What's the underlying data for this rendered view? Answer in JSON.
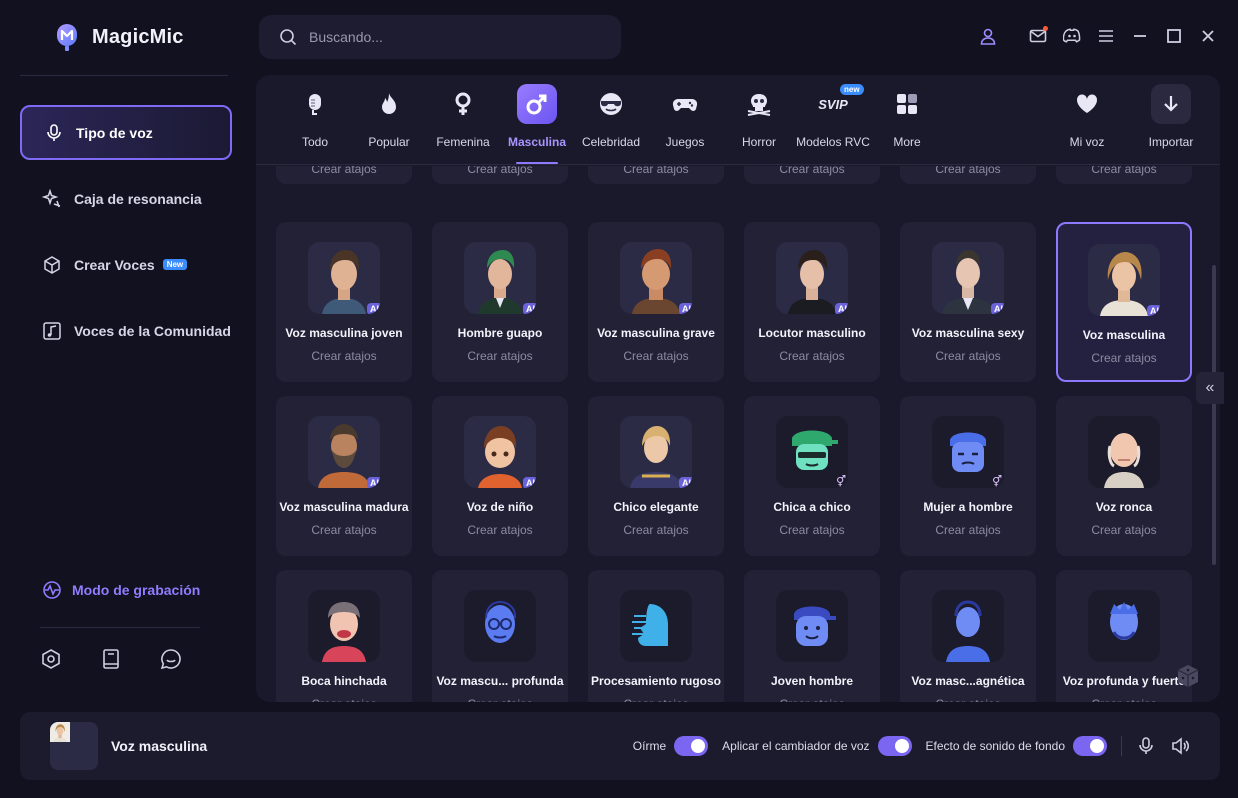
{
  "app": {
    "name": "MagicMic"
  },
  "search": {
    "placeholder": "Buscando..."
  },
  "sidebar": {
    "items": [
      {
        "label": "Tipo de voz",
        "icon": "microphone-icon",
        "active": true
      },
      {
        "label": "Caja de resonancia",
        "icon": "sparkle-icon"
      },
      {
        "label": "Crear Voces",
        "icon": "cube-icon",
        "badge": "New"
      },
      {
        "label": "Voces de la Comunidad",
        "icon": "music-note-icon"
      }
    ],
    "record_mode": "Modo de grabación"
  },
  "categories": [
    {
      "label": "Todo",
      "icon": "mic-icon"
    },
    {
      "label": "Popular",
      "icon": "flame-icon"
    },
    {
      "label": "Femenina",
      "icon": "female-symbol-icon"
    },
    {
      "label": "Masculina",
      "icon": "male-symbol-icon",
      "active": true
    },
    {
      "label": "Celebridad",
      "icon": "sunglasses-icon"
    },
    {
      "label": "Juegos",
      "icon": "gamepad-icon"
    },
    {
      "label": "Horror",
      "icon": "skull-icon"
    },
    {
      "label": "Modelos RVC",
      "icon": "svip-icon",
      "badge_text": "SVIP",
      "badge": "new"
    },
    {
      "label": "More",
      "icon": "grid-icon"
    },
    {
      "label": "Mi voz",
      "icon": "heart-icon"
    },
    {
      "label": "Importar",
      "icon": "download-icon"
    }
  ],
  "card_sub": "Crear atajos",
  "voices_row1": [
    {
      "name": "Voz masculina joven",
      "ai": "AI"
    },
    {
      "name": "Hombre guapo",
      "ai": "AI"
    },
    {
      "name": "Voz masculina grave",
      "ai": "AI"
    },
    {
      "name": "Locutor masculino",
      "ai": "AI"
    },
    {
      "name": "Voz masculina sexy",
      "ai": "AI"
    },
    {
      "name": "Voz masculina",
      "ai": "AI",
      "selected": true
    }
  ],
  "voices_row2": [
    {
      "name": "Voz masculina madura",
      "ai": "AI"
    },
    {
      "name": "Voz de niño",
      "ai": "AI"
    },
    {
      "name": "Chico elegante",
      "ai": "AI"
    },
    {
      "name": "Chica a chico",
      "gender": "⚥"
    },
    {
      "name": "Mujer a hombre",
      "gender": "⚥"
    },
    {
      "name": "Voz ronca"
    }
  ],
  "voices_row3": [
    {
      "name": "Boca hinchada"
    },
    {
      "name": "Voz mascu... profunda"
    },
    {
      "name": "Procesamiento rugoso"
    },
    {
      "name": "Joven hombre"
    },
    {
      "name": "Voz masc...agnética"
    },
    {
      "name": "Voz profunda y fuerte"
    }
  ],
  "bottom": {
    "current_voice": "Voz masculina",
    "toggles": [
      {
        "label": "Oírme",
        "on": true
      },
      {
        "label": "Aplicar el cambiador de voz",
        "on": true
      },
      {
        "label": "Efecto de sonido de fondo",
        "on": true
      }
    ]
  },
  "colors": {
    "accent": "#8e78ff",
    "background": "#12111f",
    "panel": "#1a192c",
    "card": "#222136"
  }
}
